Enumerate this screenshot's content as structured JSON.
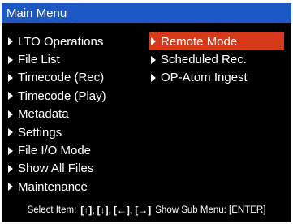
{
  "title": "Main Menu",
  "left_menu": [
    {
      "label": "LTO Operations"
    },
    {
      "label": "File List"
    },
    {
      "label": "Timecode (Rec)"
    },
    {
      "label": "Timecode (Play)"
    },
    {
      "label": "Metadata"
    },
    {
      "label": "Settings"
    },
    {
      "label": "File I/O Mode"
    },
    {
      "label": "Show All Files"
    },
    {
      "label": "Maintenance"
    }
  ],
  "right_menu": [
    {
      "label": "Remote Mode",
      "selected": true
    },
    {
      "label": "Scheduled Rec."
    },
    {
      "label": "OP-Atom Ingest"
    }
  ],
  "status": {
    "select_label": "Select Item:",
    "keys": [
      "[↑],",
      "[↓],",
      "[←],",
      "[→]"
    ],
    "submenu_label": "Show Sub Menu: [ENTER]"
  },
  "colors": {
    "title_bar": "#1b58c4",
    "selection": "#d63a1a",
    "background": "#000000",
    "text": "#ffffff"
  }
}
